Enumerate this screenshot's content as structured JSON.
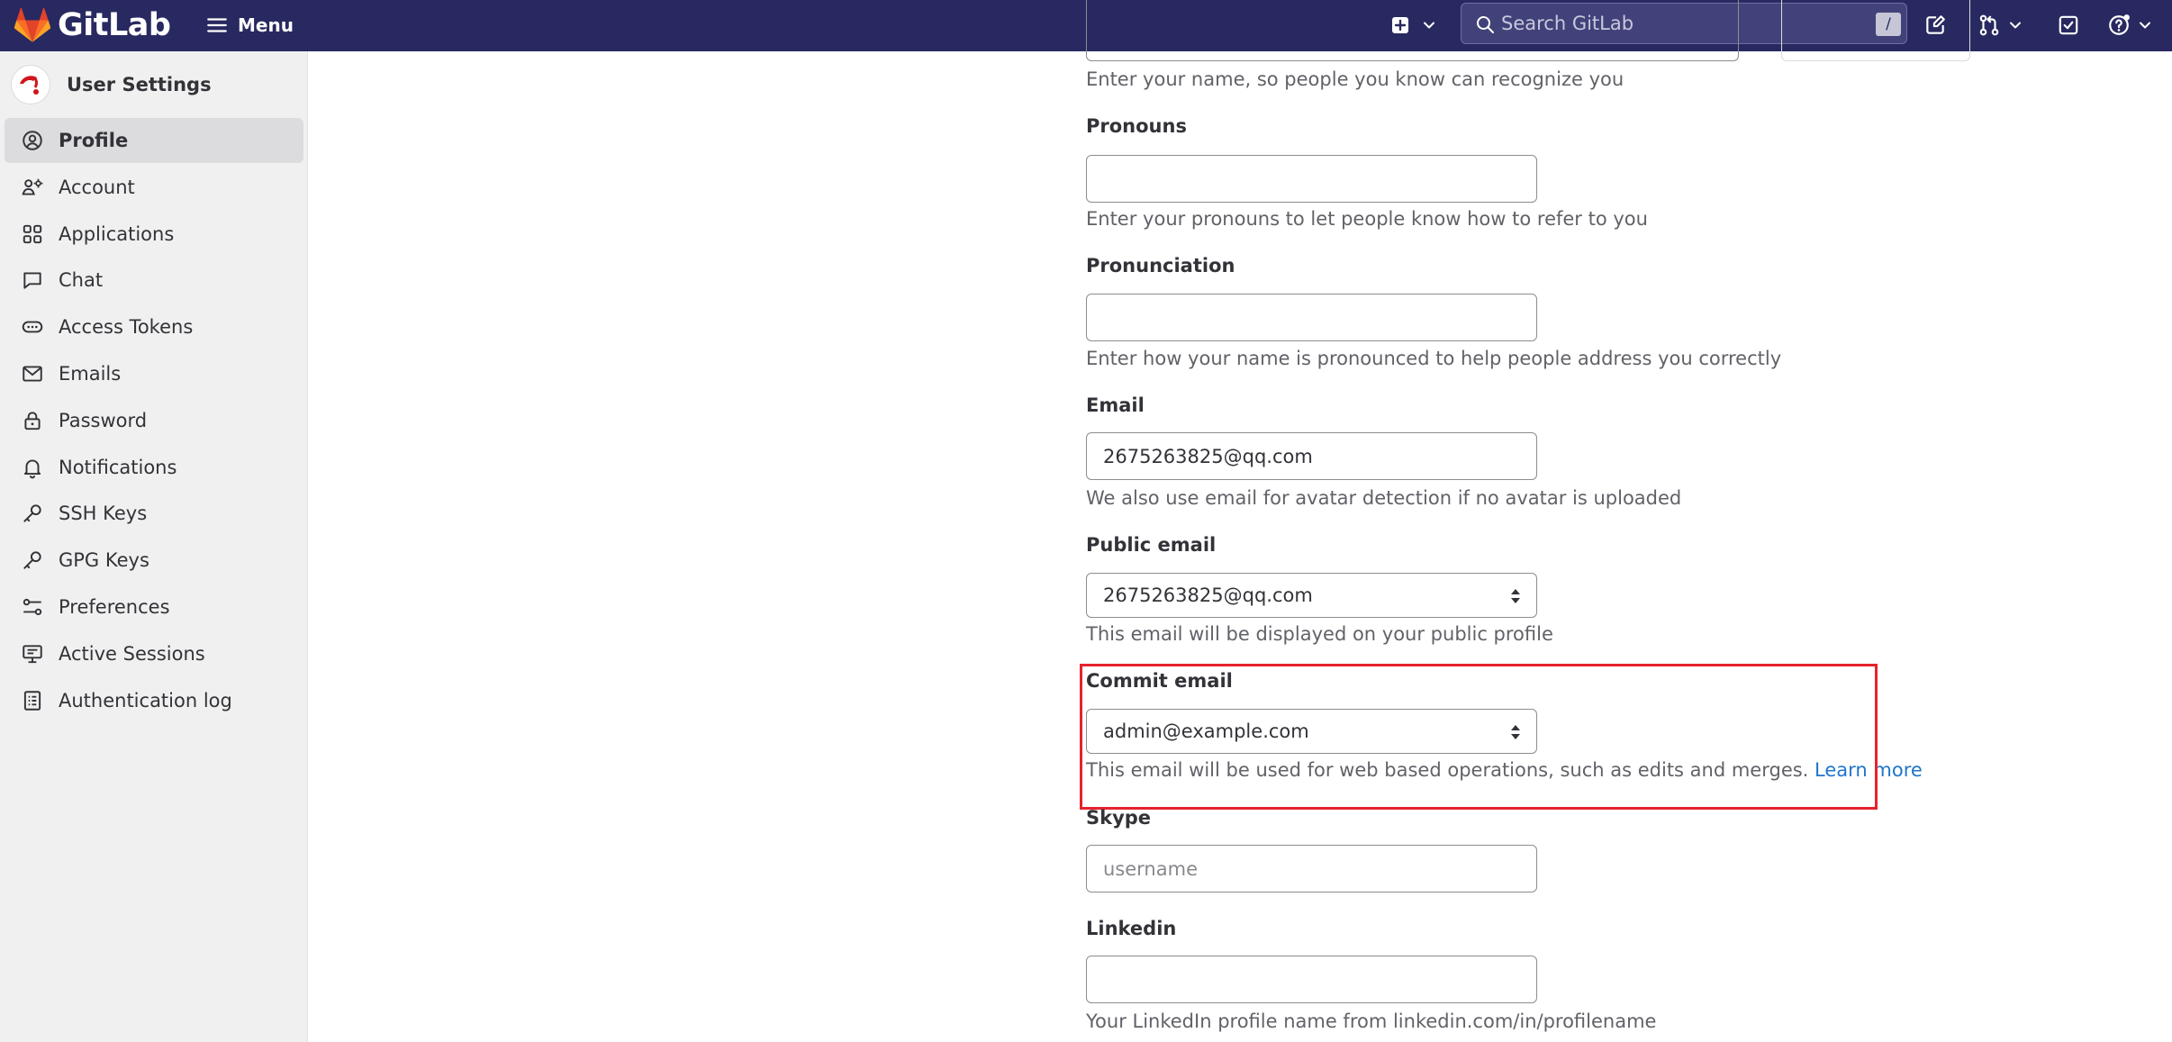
{
  "topbar": {
    "brand": "GitLab",
    "menu_label": "Menu",
    "search_placeholder": "Search GitLab",
    "search_shortcut": "/"
  },
  "sidebar": {
    "title": "User Settings",
    "items": [
      {
        "label": "Profile",
        "icon": "user-circle-icon",
        "active": true
      },
      {
        "label": "Account",
        "icon": "account-icon"
      },
      {
        "label": "Applications",
        "icon": "applications-icon"
      },
      {
        "label": "Chat",
        "icon": "chat-icon"
      },
      {
        "label": "Access Tokens",
        "icon": "token-icon"
      },
      {
        "label": "Emails",
        "icon": "mail-icon"
      },
      {
        "label": "Password",
        "icon": "lock-icon"
      },
      {
        "label": "Notifications",
        "icon": "bell-icon"
      },
      {
        "label": "SSH Keys",
        "icon": "key-icon"
      },
      {
        "label": "GPG Keys",
        "icon": "key-icon"
      },
      {
        "label": "Preferences",
        "icon": "preferences-icon"
      },
      {
        "label": "Active Sessions",
        "icon": "monitor-icon"
      },
      {
        "label": "Authentication log",
        "icon": "log-icon"
      }
    ]
  },
  "form": {
    "name_help": "Enter your name, so people you know can recognize you",
    "pronouns": {
      "label": "Pronouns",
      "value": "",
      "help": "Enter your pronouns to let people know how to refer to you"
    },
    "pronunciation": {
      "label": "Pronunciation",
      "value": "",
      "help": "Enter how your name is pronounced to help people address you correctly"
    },
    "email": {
      "label": "Email",
      "value": "2675263825@qq.com",
      "help": "We also use email for avatar detection if no avatar is uploaded"
    },
    "public_email": {
      "label": "Public email",
      "value": "2675263825@qq.com",
      "help": "This email will be displayed on your public profile"
    },
    "commit_email": {
      "label": "Commit email",
      "value": "admin@example.com",
      "help": "This email will be used for web based operations, such as edits and merges.",
      "link": "Learn more"
    },
    "skype": {
      "label": "Skype",
      "placeholder": "username",
      "value": ""
    },
    "linkedin": {
      "label": "Linkedin",
      "value": "",
      "help": "Your LinkedIn profile name from linkedin.com/in/profilename"
    }
  },
  "colors": {
    "topbar_bg": "#292961",
    "highlight": "#e6232c",
    "link": "#1f75cb"
  }
}
